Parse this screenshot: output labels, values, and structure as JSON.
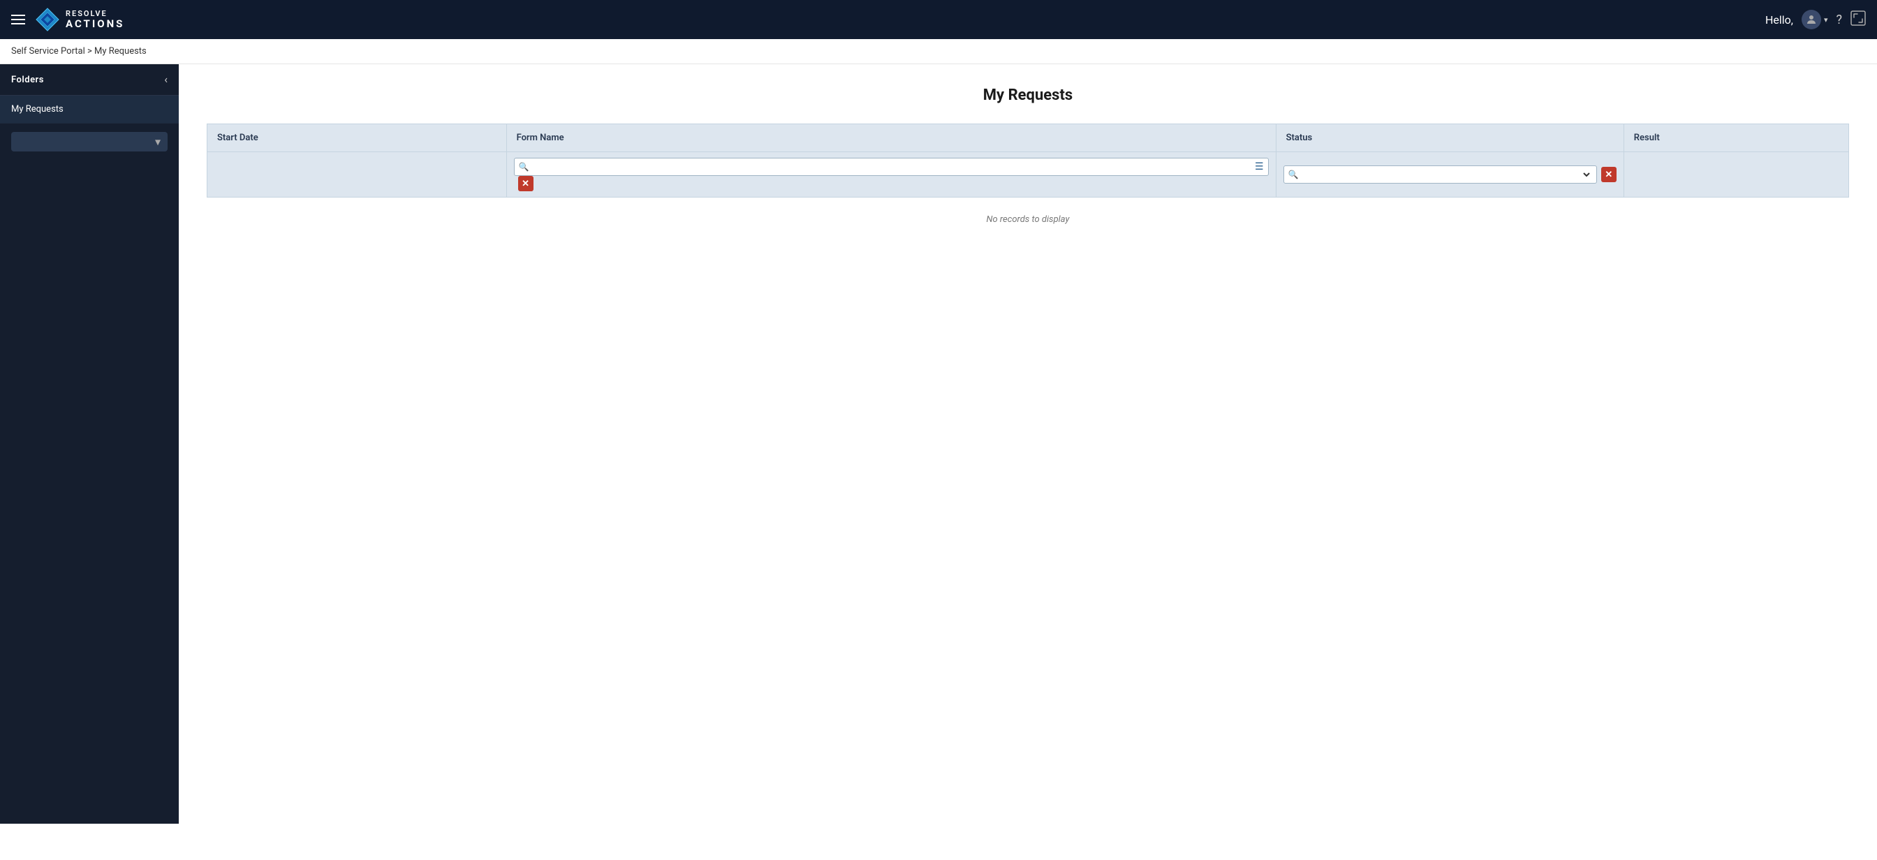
{
  "app": {
    "name": "RESOLVE ACTIONS",
    "name_line1": "RESOLVE",
    "name_line2": "ACTIONS"
  },
  "topnav": {
    "hello_prefix": "Hello,",
    "user_name": ""
  },
  "breadcrumb": {
    "label": "Self Service Portal > My Requests"
  },
  "sidebar": {
    "header": "Folders",
    "items": [
      {
        "label": "My Requests"
      }
    ],
    "dropdown_placeholder": ""
  },
  "main": {
    "page_title": "My Requests",
    "table": {
      "columns": [
        {
          "key": "start_date",
          "label": "Start Date"
        },
        {
          "key": "form_name",
          "label": "Form Name"
        },
        {
          "key": "status",
          "label": "Status"
        },
        {
          "key": "result",
          "label": "Result"
        }
      ],
      "no_records_text": "No records to display",
      "form_name_placeholder": "",
      "status_placeholder": ""
    }
  }
}
